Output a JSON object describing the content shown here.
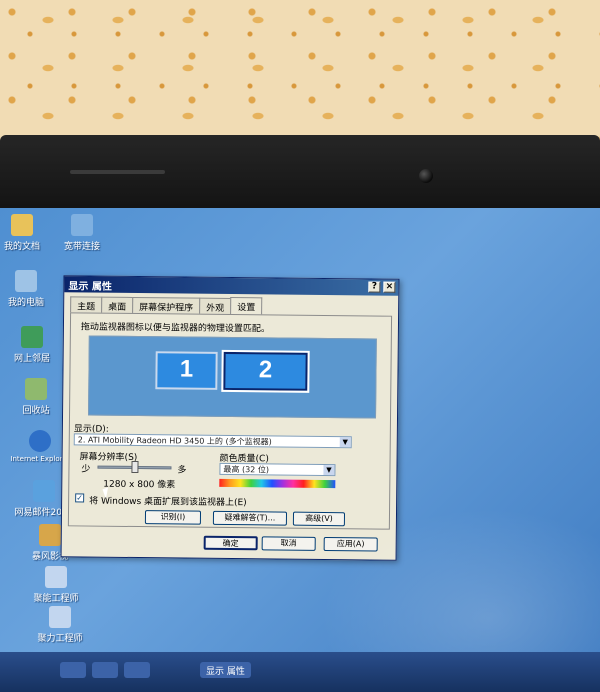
{
  "desktop": {
    "icons": [
      {
        "name": "my-documents",
        "label": "我的文档",
        "color": "#e8c25a"
      },
      {
        "name": "broadband",
        "label": "宽带连接",
        "color": "#7fb0e0"
      },
      {
        "name": "my-computer",
        "label": "我的电脑",
        "color": "#9ec3e6"
      },
      {
        "name": "network-places",
        "label": "网上邻居",
        "color": "#3f9c5a"
      },
      {
        "name": "recycle-bin",
        "label": "回收站",
        "color": "#8fb96e"
      },
      {
        "name": "internet-explorer",
        "label": "Internet Explorer",
        "color": "#2e6fc7"
      },
      {
        "name": "app-2015",
        "label": "网易邮件2015",
        "color": "#5aa1de"
      },
      {
        "name": "video",
        "label": "暴风影视",
        "color": "#d7a64a"
      },
      {
        "name": "app-7",
        "label": "聚能工程师",
        "color": "#c2d6ef"
      },
      {
        "name": "app-8",
        "label": "聚力工程师",
        "color": "#c2d6ef"
      }
    ]
  },
  "taskbar": {
    "window_label": "显示 属性"
  },
  "dialog": {
    "title": "显示 属性",
    "help": "?",
    "close": "×",
    "tabs": [
      "主题",
      "桌面",
      "屏幕保护程序",
      "外观",
      "设置"
    ],
    "active_tab_index": 4,
    "hint": "拖动监视器图标以便与监视器的物理设置匹配。",
    "monitors": [
      "1",
      "2"
    ],
    "selected_monitor": "2",
    "display_label": "显示(D):",
    "display_value": "2. ATI Mobility Radeon HD 3450 上的 (多个监视器)",
    "resolution_label": "屏幕分辨率(S)",
    "res_less": "少",
    "res_more": "多",
    "resolution_value": "1280 x 800 像素",
    "resolution_level": 0.5,
    "color_label": "颜色质量(C)",
    "color_value": "最高 (32 位)",
    "extend_label": "将 Windows 桌面扩展到该监视器上(E)",
    "extend_checked": true,
    "identify": "识别(I)",
    "troubleshoot": "疑难解答(T)...",
    "advanced": "高级(V)",
    "ok": "确定",
    "cancel": "取消",
    "apply": "应用(A)"
  }
}
